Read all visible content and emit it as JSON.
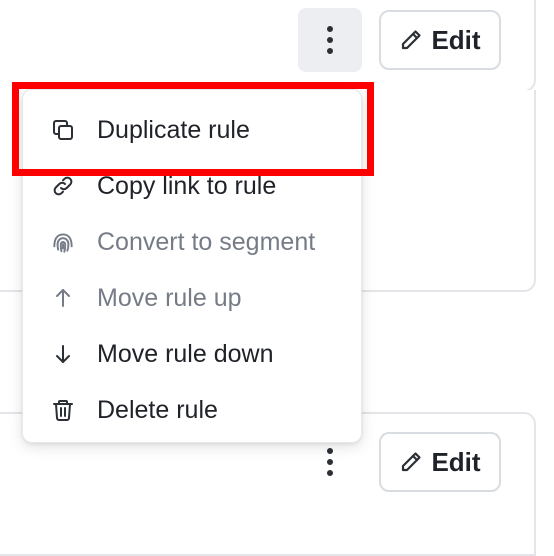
{
  "rules": [
    {
      "edit_label": "Edit",
      "more_icon": "more-vertical-icon",
      "edit_icon": "pencil-icon"
    },
    {
      "edit_label": "Edit",
      "more_icon": "more-vertical-icon",
      "edit_icon": "pencil-icon"
    }
  ],
  "menu": {
    "items": [
      {
        "label": "Duplicate rule",
        "icon": "copy-icon",
        "disabled": false,
        "highlighted": true
      },
      {
        "label": "Copy link to rule",
        "icon": "link-icon",
        "disabled": false
      },
      {
        "label": "Convert to segment",
        "icon": "fingerprint-icon",
        "disabled": true
      },
      {
        "label": "Move rule up",
        "icon": "arrow-up-icon",
        "disabled": true
      },
      {
        "label": "Move rule down",
        "icon": "arrow-down-icon",
        "disabled": false
      },
      {
        "label": "Delete rule",
        "icon": "trash-icon",
        "disabled": false
      }
    ]
  },
  "colors": {
    "highlight": "#ff0000",
    "disabled_text": "#767c87",
    "text": "#1f2228",
    "border": "#e3e5e8",
    "active_bg": "#eceef1"
  }
}
